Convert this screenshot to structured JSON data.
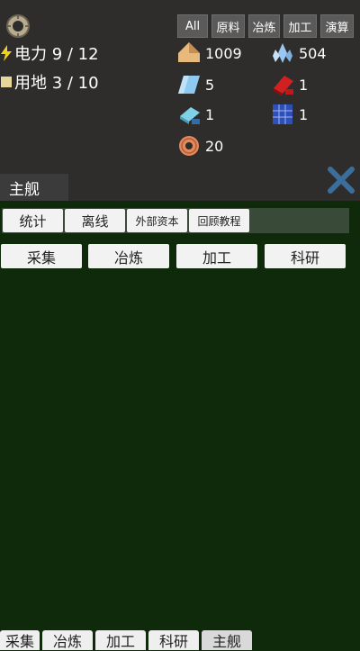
{
  "header": {
    "power_label": "电力 9 / 12",
    "land_label": "用地 3 / 10"
  },
  "filters": [
    "All",
    "原料",
    "冶炼",
    "加工",
    "演算"
  ],
  "resources": [
    {
      "icon": "wood-planks-icon",
      "value": "1009"
    },
    {
      "icon": "crystal-icon",
      "value": "504"
    },
    {
      "icon": "glass-sheet-icon",
      "value": "5"
    },
    {
      "icon": "copper-ingot-icon",
      "value": "1"
    },
    {
      "icon": "iron-ingot-icon",
      "value": "1"
    },
    {
      "icon": "solar-panel-icon",
      "value": "1"
    },
    {
      "icon": "copper-coil-icon",
      "value": "20"
    }
  ],
  "tab": {
    "label": "主舰"
  },
  "subnav": [
    "统计",
    "离线",
    "外部资本",
    "回顾教程"
  ],
  "categories": [
    "采集",
    "冶炼",
    "加工",
    "科研"
  ],
  "bottom_tabs": [
    "采集",
    "冶炼",
    "加工",
    "科研",
    "主舰"
  ],
  "colors": {
    "panel": "#2e2d2c",
    "main_bg": "#0f2a0b",
    "close": "#3b6e9a"
  }
}
